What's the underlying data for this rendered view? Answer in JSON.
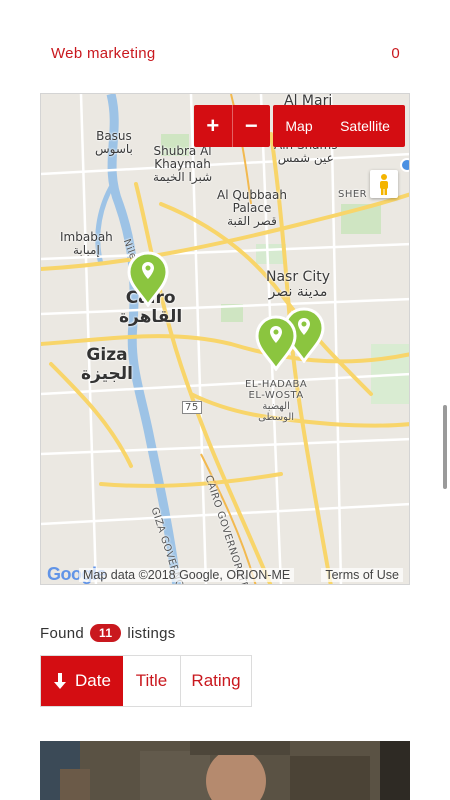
{
  "category": {
    "name": "Web marketing",
    "count": "0"
  },
  "map": {
    "labels": {
      "al_marj": "Al Marj",
      "basus": "Basus\nباسوس",
      "shubra": "Shubra Al\nKhaymah\nشبرا الخيمة",
      "ain_shams": "Ain Shams\nعين شمس",
      "qubbaah": "Al Qubbaah\nPalace\nقصر القبة",
      "imbabah": "Imbabah\nإمبابة",
      "sher": "SHER",
      "nasr": "Nasr City\nمدينة نصر",
      "cairo": "Cairo\nالقاهرة",
      "giza": "Giza\nالجيزة",
      "hadaba": "EL-HADABA\nEL-WOSTA\nالهضبة\nالوسطى",
      "road75": "75",
      "nile": "Nile",
      "cairo_gov": "CAIRO GOVERNORATE",
      "giza_gov": "GIZA GOVERNORATE"
    },
    "controls": {
      "zoom_in": "+",
      "zoom_out": "−",
      "map": "Map",
      "satellite": "Satellite"
    },
    "google_logo": "Google",
    "attribution": "Map data ©2018 Google, ORION-ME",
    "terms": "Terms of Use"
  },
  "listings": {
    "found_label": "Found",
    "count": "11",
    "suffix": "listings"
  },
  "sort": {
    "date": "Date",
    "title": "Title",
    "rating": "Rating"
  },
  "colors": {
    "accent": "#d40d12",
    "marker": "#8bc53f"
  }
}
